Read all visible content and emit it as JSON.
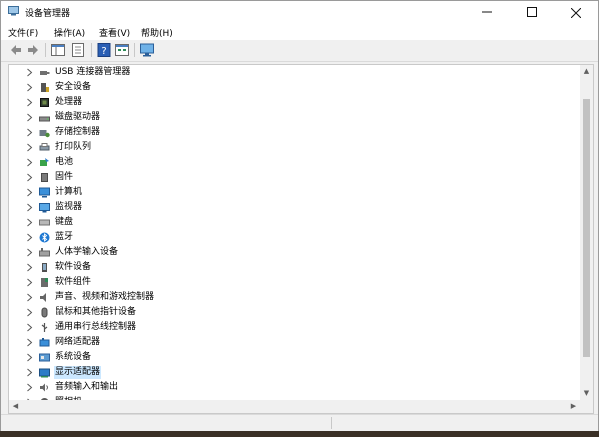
{
  "window": {
    "title": "设备管理器"
  },
  "menu": {
    "file": "文件(F)",
    "action": "操作(A)",
    "view": "查看(V)",
    "help": "帮助(H)"
  },
  "tree": {
    "items": [
      {
        "label": "USB 连接器管理器",
        "icon": "usb-connector-icon"
      },
      {
        "label": "安全设备",
        "icon": "security-device-icon"
      },
      {
        "label": "处理器",
        "icon": "processor-icon"
      },
      {
        "label": "磁盘驱动器",
        "icon": "disk-drive-icon"
      },
      {
        "label": "存储控制器",
        "icon": "storage-controller-icon"
      },
      {
        "label": "打印队列",
        "icon": "print-queue-icon"
      },
      {
        "label": "电池",
        "icon": "battery-icon"
      },
      {
        "label": "固件",
        "icon": "firmware-icon"
      },
      {
        "label": "计算机",
        "icon": "computer-icon"
      },
      {
        "label": "监视器",
        "icon": "monitor-icon"
      },
      {
        "label": "键盘",
        "icon": "keyboard-icon"
      },
      {
        "label": "蓝牙",
        "icon": "bluetooth-icon"
      },
      {
        "label": "人体学输入设备",
        "icon": "hid-icon"
      },
      {
        "label": "软件设备",
        "icon": "software-device-icon"
      },
      {
        "label": "软件组件",
        "icon": "software-component-icon"
      },
      {
        "label": "声音、视频和游戏控制器",
        "icon": "sound-icon"
      },
      {
        "label": "鼠标和其他指针设备",
        "icon": "mouse-icon"
      },
      {
        "label": "通用串行总线控制器",
        "icon": "usb-icon"
      },
      {
        "label": "网络适配器",
        "icon": "network-adapter-icon"
      },
      {
        "label": "系统设备",
        "icon": "system-device-icon"
      },
      {
        "label": "显示适配器",
        "icon": "display-adapter-icon",
        "selected": true
      },
      {
        "label": "音频输入和输出",
        "icon": "audio-io-icon"
      },
      {
        "label": "照相机",
        "icon": "camera-icon"
      }
    ]
  },
  "colors": {
    "selection": "#cce8ff",
    "desktop": "#3a3026"
  }
}
